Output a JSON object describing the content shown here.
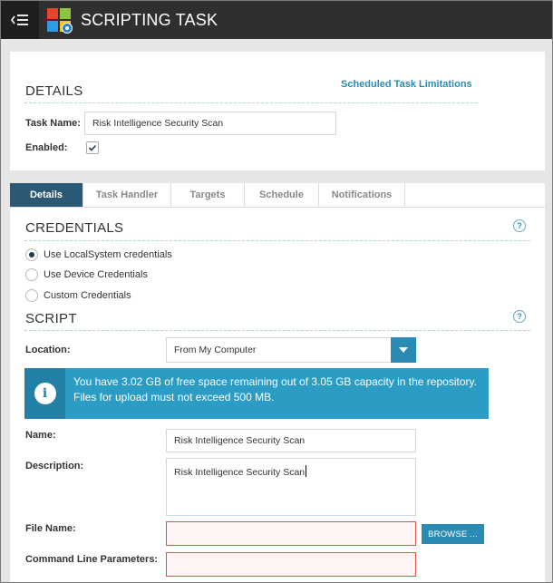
{
  "window": {
    "title": "SCRIPTING TASK"
  },
  "colors": {
    "accent": "#2a8cb5",
    "active_tab": "#2b5874",
    "titlebar": "#2f2f2f",
    "info_bg": "#2b9cc4",
    "error_border": "#d9534f"
  },
  "details": {
    "heading": "DETAILS",
    "limitations_link": "Scheduled Task Limitations",
    "task_name_label": "Task Name:",
    "task_name_value": "Risk Intelligence Security Scan",
    "enabled_label": "Enabled:",
    "enabled_checked": true
  },
  "tabs": [
    {
      "label": "Details",
      "active": true
    },
    {
      "label": "Task Handler",
      "active": false
    },
    {
      "label": "Targets",
      "active": false
    },
    {
      "label": "Schedule",
      "active": false
    },
    {
      "label": "Notifications",
      "active": false
    }
  ],
  "credentials": {
    "heading": "CREDENTIALS",
    "help": "?",
    "options": [
      {
        "label": "Use LocalSystem credentials",
        "selected": true
      },
      {
        "label": "Use Device Credentials",
        "selected": false
      },
      {
        "label": "Custom Credentials",
        "selected": false
      }
    ]
  },
  "script": {
    "heading": "SCRIPT",
    "help": "?",
    "location_label": "Location:",
    "location_value": "From My Computer",
    "info_icon": "i",
    "info_text": "You have 3.02 GB of free space remaining out of 3.05 GB capacity in the repository. Files for upload must not exceed 500 MB.",
    "name_label": "Name:",
    "name_value": "Risk Intelligence Security Scan",
    "description_label": "Description:",
    "description_value": "Risk Intelligence Security Scan",
    "file_name_label": "File Name:",
    "file_name_value": "",
    "browse_label": "BROWSE ...",
    "cmd_label": "Command Line Parameters:",
    "cmd_value": ""
  }
}
